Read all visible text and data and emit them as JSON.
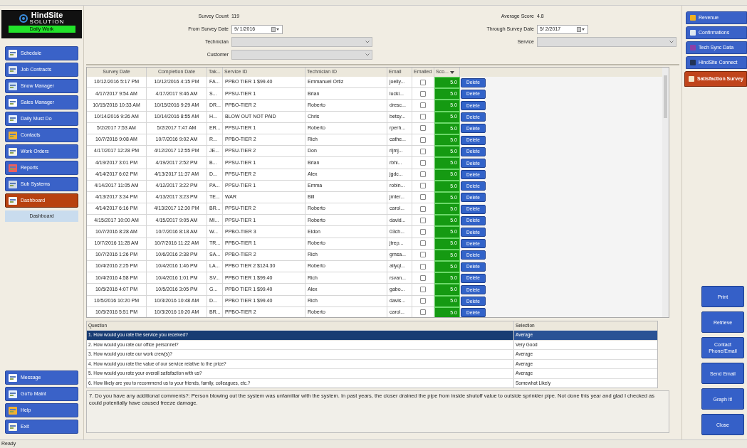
{
  "sidebar": {
    "logo": {
      "brand": "HindSite",
      "tagline": "SOLUTION",
      "badge": "Daily Work"
    },
    "items": [
      {
        "label": "Schedule",
        "selected": false
      },
      {
        "label": "Job Contracts",
        "selected": false
      },
      {
        "label": "Snow Manager",
        "selected": false
      },
      {
        "label": "Sales Manager",
        "selected": false
      },
      {
        "label": "Daily Must Do",
        "selected": false
      },
      {
        "label": "Contacts",
        "selected": false
      },
      {
        "label": "Work Orders",
        "selected": false
      },
      {
        "label": "Reports",
        "selected": false
      },
      {
        "label": "Sub Systems",
        "selected": false
      },
      {
        "label": "Dashboard",
        "selected": true
      }
    ],
    "sub_items": [
      "Dashboard"
    ],
    "bottom_items": [
      "Message",
      "GoTo Maint",
      "Help",
      "Exit"
    ]
  },
  "filters": {
    "survey_count": {
      "label": "Survey Count",
      "value": "119"
    },
    "average_score": {
      "label": "Average Score",
      "value": "4.8"
    },
    "from_date": {
      "label": "From Survey Date",
      "value": "9/  1/2016"
    },
    "through_date": {
      "label": "Through Survey Date",
      "value": "5/  2/2017"
    },
    "technician": {
      "label": "Technician"
    },
    "customer": {
      "label": "Customer"
    },
    "service": {
      "label": "Service"
    }
  },
  "table": {
    "columns": [
      "Survey Date",
      "Completion Date",
      "Tak...",
      "Service ID",
      "Technician ID",
      "Email",
      "Emailed",
      "Sco..."
    ],
    "rows": [
      {
        "cells": [
          "10/12/2016 5:17 PM",
          "10/12/2016 4:15 PM",
          "FA...",
          "PPBO TIER 1 $99.40",
          "Emmanuel Ortiz",
          "joelly..."
        ],
        "emailed": false,
        "score": "5.0",
        "action": "Delete"
      },
      {
        "cells": [
          "4/17/2017 9:54 AM",
          "4/17/2017 9:46 AM",
          "S...",
          "PPSU-TIER 1",
          "Brian",
          "lucki..."
        ],
        "emailed": false,
        "score": "5.0",
        "action": "Delete"
      },
      {
        "cells": [
          "10/15/2016 10:33 AM",
          "10/15/2016 9:29 AM",
          "DR...",
          "PPBO-TIER 2",
          "Roberto",
          "dresc..."
        ],
        "emailed": false,
        "score": "5.0",
        "action": "Delete"
      },
      {
        "cells": [
          "10/14/2016 9:26 AM",
          "10/14/2016 8:55 AM",
          "H...",
          "BLOW OUT NOT PAID",
          "Chris",
          "betsy..."
        ],
        "emailed": false,
        "score": "5.0",
        "action": "Delete"
      },
      {
        "cells": [
          "5/2/2017 7:53 AM",
          "5/2/2017 7:47 AM",
          "ER...",
          "PPSU-TIER 1",
          "Roberto",
          "rperh..."
        ],
        "emailed": false,
        "score": "5.0",
        "action": "Delete"
      },
      {
        "cells": [
          "10/7/2016 9:08 AM",
          "10/7/2016 9:02 AM",
          "R...",
          "PPBO-TIER 2",
          "Rich",
          "cathe..."
        ],
        "emailed": false,
        "score": "5.0",
        "action": "Delete"
      },
      {
        "cells": [
          "4/17/2017 12:28 PM",
          "4/12/2017 12:55 PM",
          "JE...",
          "PPSU-TIER 2",
          "Don",
          "rljmj..."
        ],
        "emailed": false,
        "score": "5.0",
        "action": "Delete"
      },
      {
        "cells": [
          "4/19/2017 3:01 PM",
          "4/19/2017 2:52 PM",
          "B...",
          "PPSU-TIER 1",
          "Brian",
          "rbhi..."
        ],
        "emailed": false,
        "score": "5.0",
        "action": "Delete"
      },
      {
        "cells": [
          "4/14/2017 6:02 PM",
          "4/13/2017 11:37 AM",
          "D...",
          "PPSU-TIER 2",
          "Alex",
          "jgdc..."
        ],
        "emailed": false,
        "score": "5.0",
        "action": "Delete"
      },
      {
        "cells": [
          "4/14/2017 11:05 AM",
          "4/12/2017 3:22 PM",
          "PA...",
          "PPSU-TIER 1",
          "Emma",
          "robin..."
        ],
        "emailed": false,
        "score": "5.0",
        "action": "Delete"
      },
      {
        "cells": [
          "4/13/2017 3:34 PM",
          "4/13/2017 3:23 PM",
          "TE...",
          "WAR",
          "Bill",
          "jmter..."
        ],
        "emailed": false,
        "score": "5.0",
        "action": "Delete"
      },
      {
        "cells": [
          "4/14/2017 6:16 PM",
          "4/13/2017 12:30 PM",
          "BR...",
          "PPSU-TIER 2",
          "Roberto",
          "carol..."
        ],
        "emailed": false,
        "score": "5.0",
        "action": "Delete"
      },
      {
        "cells": [
          "4/15/2017 10:00 AM",
          "4/15/2017 9:05 AM",
          "MI...",
          "PPSU-TIER 1",
          "Roberto",
          "david..."
        ],
        "emailed": false,
        "score": "5.0",
        "action": "Delete"
      },
      {
        "cells": [
          "10/7/2016 8:28 AM",
          "10/7/2016 8:18 AM",
          "W...",
          "PPBO-TIER 3",
          "Eldon",
          "03ch..."
        ],
        "emailed": false,
        "score": "5.0",
        "action": "Delete"
      },
      {
        "cells": [
          "10/7/2016 11:28 AM",
          "10/7/2016 11:22 AM",
          "TR...",
          "PPBO-TIER 1",
          "Roberto",
          "jtrep..."
        ],
        "emailed": false,
        "score": "5.0",
        "action": "Delete"
      },
      {
        "cells": [
          "10/7/2016 1:26 PM",
          "10/6/2016 2:38 PM",
          "SA...",
          "PPBO-TIER 2",
          "Rich",
          "gmsa..."
        ],
        "emailed": false,
        "score": "5.0",
        "action": "Delete"
      },
      {
        "cells": [
          "10/4/2016 2:25 PM",
          "10/4/2016 1:46 PM",
          "LA...",
          "PPBO TIER 2 $124.30",
          "Roberto",
          "allyql..."
        ],
        "emailed": false,
        "score": "5.0",
        "action": "Delete"
      },
      {
        "cells": [
          "10/4/2016 4:58 PM",
          "10/4/2016 1:01 PM",
          "SV...",
          "PPBO TIER 1 $99.40",
          "Rich",
          "rsvan..."
        ],
        "emailed": false,
        "score": "5.0",
        "action": "Delete"
      },
      {
        "cells": [
          "10/5/2016 4:07 PM",
          "10/5/2016 3:05 PM",
          "G...",
          "PPBO TIER 1 $99.40",
          "Alex",
          "gabo..."
        ],
        "emailed": false,
        "score": "5.0",
        "action": "Delete"
      },
      {
        "cells": [
          "10/5/2016 10:20 PM",
          "10/3/2016 10:48 AM",
          "D...",
          "PPBO TIER 1 $99.40",
          "Rich",
          "davis..."
        ],
        "emailed": false,
        "score": "5.0",
        "action": "Delete"
      },
      {
        "cells": [
          "10/5/2016 5:51 PM",
          "10/3/2016 10:20 AM",
          "BR...",
          "PPBO-TIER 2",
          "Roberto",
          "carol..."
        ],
        "emailed": false,
        "score": "5.0",
        "action": "Delete"
      }
    ]
  },
  "questions": {
    "columns": [
      "Question",
      "Selection"
    ],
    "rows": [
      {
        "question": "1. How would you rate the service you received?",
        "selection": "Average",
        "selected": true
      },
      {
        "question": "2. How would you rate our office personnel?",
        "selection": "Very Good",
        "selected": false
      },
      {
        "question": "3. How would you rate our work crew(s)?",
        "selection": "Average",
        "selected": false
      },
      {
        "question": "4. How would you rate the value of our service relative to the price?",
        "selection": "Average",
        "selected": false
      },
      {
        "question": "5. How would you rate your overall satisfaction with us?",
        "selection": "Average",
        "selected": false
      },
      {
        "question": "6. How likely are you to recommend us to your friends, family, colleagues, etc.?",
        "selection": "Somewhat Likely",
        "selected": false
      }
    ],
    "comments": "7. Do you have any additional comments?: Person blowing out the system was unfamiliar with the system.   In past years, the closer drained the pipe from inside shutoff value to outside sprinkler pipe.  Not done this year and glad I checked as could potentially have caused freeze damage."
  },
  "right_tabs": [
    {
      "label": "Revenue",
      "selected": false
    },
    {
      "label": "Confirmations",
      "selected": false
    },
    {
      "label": "Tech Sync Data",
      "selected": false
    },
    {
      "label": "HindSite Connect",
      "selected": false
    },
    {
      "label": "Satisfaction Survey",
      "selected": true
    }
  ],
  "actions": [
    "Print",
    "Retrieve",
    "Contact Phone/Email",
    "Send Email",
    "Graph it!",
    "Close"
  ],
  "status_bar": "Ready"
}
